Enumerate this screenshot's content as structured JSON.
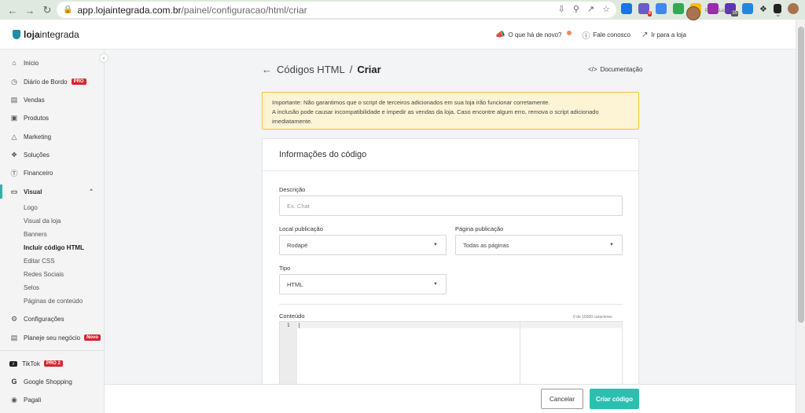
{
  "browser": {
    "url_host": "app.lojaintegrada.com.br",
    "url_path": "/painel/configuracao/html/criar",
    "extension_colors": [
      "#1a73e8",
      "#6a5acd",
      "#4285f4",
      "#34a853",
      "#fbbc05",
      "#9c27b0",
      "#5e35b1",
      "#1e88e5",
      "#333333",
      "#222222"
    ],
    "ext_badge_1": "8",
    "ext_badge_2": "35"
  },
  "header": {
    "logo_bold": "loja",
    "logo_rest": "integrada",
    "news_label": "O que há de novo?",
    "contact_label": "Fale conosco",
    "store_label": "Ir para a loja",
    "user_name": "Pedro Licin"
  },
  "sidebar": {
    "items": [
      {
        "label": "Início",
        "icon": "home-icon"
      },
      {
        "label": "Diário de Bordo",
        "icon": "clock-icon",
        "badge": "PRO"
      },
      {
        "label": "Vendas",
        "icon": "list-icon"
      },
      {
        "label": "Produtos",
        "icon": "box-icon"
      },
      {
        "label": "Marketing",
        "icon": "megaphone-icon"
      },
      {
        "label": "Soluções",
        "icon": "puzzle-icon"
      },
      {
        "label": "Financeiro",
        "icon": "dollar-icon"
      },
      {
        "label": "Visual",
        "icon": "monitor-icon"
      }
    ],
    "visual_sub": [
      "Logo",
      "Visual da loja",
      "Banners",
      "Incluir código HTML",
      "Editar CSS",
      "Redes Sociais",
      "Selos",
      "Páginas de conteúdo"
    ],
    "config_label": "Configurações",
    "plan_label": "Planeje seu negócio",
    "plan_badge": "Novo",
    "tiktok_label": "TikTok",
    "tiktok_badge": "PRO 2",
    "google_label": "Google Shopping",
    "pagali_label": "Pagali"
  },
  "page": {
    "breadcrumb": "Códigos HTML",
    "separator": "/",
    "title": "Criar",
    "doc_label": "Documentação",
    "alert_line1": "Importante: Não garantimos que o script de terceiros adicionados em sua loja irão funcionar corretamente.",
    "alert_line2": "A inclusão pode causar incompatibilidade e impedir as vendas da loja. Caso encontre algum erro, remova o script adicionado imediatamente."
  },
  "form": {
    "card_title": "Informações do código",
    "description_label": "Descrição",
    "description_placeholder": "Ex. Chat",
    "location_label": "Local publicação",
    "location_value": "Rodapé",
    "page_label": "Página publicação",
    "page_value": "Todas as páginas",
    "type_label": "Tipo",
    "type_value": "HTML",
    "content_label": "Conteúdo",
    "char_count": "0 de 15000 caracteres",
    "line_number": "1"
  },
  "footer": {
    "cancel_label": "Cancelar",
    "create_label": "Criar código"
  }
}
